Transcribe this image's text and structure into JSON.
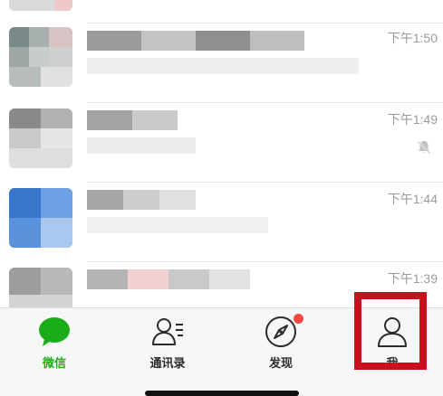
{
  "chats": [
    {
      "time": "下午1:50"
    },
    {
      "time": "下午1:49",
      "muted_icon": "bell-off-icon"
    },
    {
      "time": "下午1:44"
    },
    {
      "time": "下午1:39"
    }
  ],
  "tabbar": {
    "tabs": [
      {
        "label": "微信",
        "icon": "chat-bubble-icon",
        "active": true
      },
      {
        "label": "通讯录",
        "icon": "contacts-icon",
        "active": false
      },
      {
        "label": "发现",
        "icon": "compass-icon",
        "active": false,
        "badge": "red-dot"
      },
      {
        "label": "我",
        "icon": "person-icon",
        "active": false
      }
    ],
    "active_color": "#1aad19",
    "highlight_color": "#c8101e"
  }
}
